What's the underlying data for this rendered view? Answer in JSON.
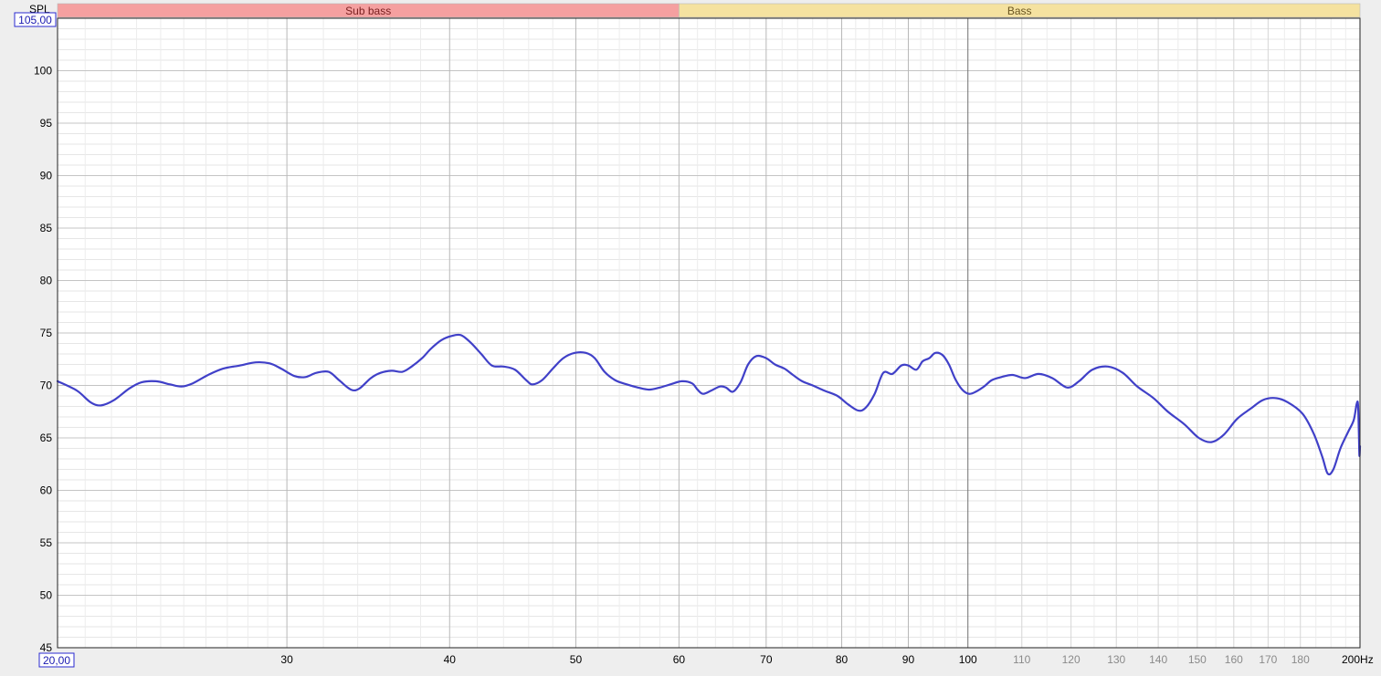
{
  "chart_data": {
    "type": "line",
    "ylabel": "SPL",
    "xunit": "Hz",
    "xscale": "log",
    "xlim": [
      20,
      200
    ],
    "ylim": [
      45,
      105
    ],
    "xlim_box": "20,00",
    "ylim_box": "105,00",
    "grid": true,
    "bands": [
      {
        "name": "Sub bass",
        "from": 20,
        "to": 60,
        "color": "#f5a0a0",
        "text_color": "#7a2020"
      },
      {
        "name": "Bass",
        "from": 60,
        "to": 200,
        "color": "#f5e2a0",
        "text_color": "#6a5520"
      }
    ],
    "x_ticks": [
      {
        "value": 30,
        "label": "30",
        "style": "major"
      },
      {
        "value": 40,
        "label": "40",
        "style": "major"
      },
      {
        "value": 50,
        "label": "50",
        "style": "major"
      },
      {
        "value": 60,
        "label": "60",
        "style": "major"
      },
      {
        "value": 70,
        "label": "70",
        "style": "major"
      },
      {
        "value": 80,
        "label": "80",
        "style": "major"
      },
      {
        "value": 90,
        "label": "90",
        "style": "major"
      },
      {
        "value": 100,
        "label": "100",
        "style": "decade"
      },
      {
        "value": 110,
        "label": "110",
        "style": "minor"
      },
      {
        "value": 120,
        "label": "120",
        "style": "minor"
      },
      {
        "value": 130,
        "label": "130",
        "style": "minor"
      },
      {
        "value": 140,
        "label": "140",
        "style": "minor"
      },
      {
        "value": 150,
        "label": "150",
        "style": "minor"
      },
      {
        "value": 160,
        "label": "160",
        "style": "minor"
      },
      {
        "value": 170,
        "label": "170",
        "style": "minor"
      },
      {
        "value": 180,
        "label": "180",
        "style": "minor"
      },
      {
        "value": 200,
        "label": "200Hz",
        "style": "end"
      }
    ],
    "y_ticks": [
      {
        "value": 45,
        "label": "45"
      },
      {
        "value": 50,
        "label": "50"
      },
      {
        "value": 55,
        "label": "55"
      },
      {
        "value": 60,
        "label": "60"
      },
      {
        "value": 65,
        "label": "65"
      },
      {
        "value": 70,
        "label": "70"
      },
      {
        "value": 75,
        "label": "75"
      },
      {
        "value": 80,
        "label": "80"
      },
      {
        "value": 85,
        "label": "85"
      },
      {
        "value": 90,
        "label": "90"
      },
      {
        "value": 95,
        "label": "95"
      },
      {
        "value": 100,
        "label": "100"
      }
    ],
    "series": [
      {
        "color": "#4040c8",
        "points": [
          [
            20.0,
            70.4
          ],
          [
            20.7,
            69.5
          ],
          [
            21.2,
            68.4
          ],
          [
            21.6,
            68.1
          ],
          [
            22.1,
            68.6
          ],
          [
            22.7,
            69.7
          ],
          [
            23.2,
            70.3
          ],
          [
            23.8,
            70.4
          ],
          [
            24.4,
            70.1
          ],
          [
            24.9,
            69.9
          ],
          [
            25.4,
            70.2
          ],
          [
            26.1,
            71.0
          ],
          [
            26.8,
            71.6
          ],
          [
            27.6,
            71.9
          ],
          [
            28.4,
            72.2
          ],
          [
            29.1,
            72.1
          ],
          [
            29.7,
            71.6
          ],
          [
            30.4,
            70.9
          ],
          [
            31.0,
            70.8
          ],
          [
            31.6,
            71.2
          ],
          [
            32.3,
            71.3
          ],
          [
            32.9,
            70.5
          ],
          [
            33.6,
            69.6
          ],
          [
            34.1,
            69.7
          ],
          [
            34.8,
            70.7
          ],
          [
            35.4,
            71.2
          ],
          [
            36.1,
            71.4
          ],
          [
            36.8,
            71.3
          ],
          [
            37.4,
            71.8
          ],
          [
            38.1,
            72.6
          ],
          [
            38.7,
            73.5
          ],
          [
            39.4,
            74.3
          ],
          [
            40.1,
            74.7
          ],
          [
            40.8,
            74.8
          ],
          [
            41.5,
            74.1
          ],
          [
            42.3,
            73.0
          ],
          [
            43.1,
            71.9
          ],
          [
            44.0,
            71.8
          ],
          [
            44.9,
            71.5
          ],
          [
            45.8,
            70.5
          ],
          [
            46.3,
            70.1
          ],
          [
            47.1,
            70.5
          ],
          [
            48.0,
            71.6
          ],
          [
            48.9,
            72.6
          ],
          [
            49.9,
            73.1
          ],
          [
            50.9,
            73.1
          ],
          [
            51.7,
            72.6
          ],
          [
            52.6,
            71.3
          ],
          [
            53.6,
            70.5
          ],
          [
            54.7,
            70.1
          ],
          [
            55.8,
            69.8
          ],
          [
            56.9,
            69.6
          ],
          [
            58.0,
            69.8
          ],
          [
            59.1,
            70.1
          ],
          [
            60.3,
            70.4
          ],
          [
            61.4,
            70.2
          ],
          [
            62.0,
            69.6
          ],
          [
            62.6,
            69.2
          ],
          [
            63.5,
            69.5
          ],
          [
            64.5,
            69.9
          ],
          [
            65.2,
            69.8
          ],
          [
            66.0,
            69.4
          ],
          [
            66.9,
            70.3
          ],
          [
            67.8,
            72.0
          ],
          [
            68.8,
            72.8
          ],
          [
            70.0,
            72.6
          ],
          [
            71.1,
            72.0
          ],
          [
            72.3,
            71.6
          ],
          [
            73.4,
            71.0
          ],
          [
            74.6,
            70.4
          ],
          [
            76.0,
            70.0
          ],
          [
            77.6,
            69.5
          ],
          [
            79.4,
            69.0
          ],
          [
            80.9,
            68.2
          ],
          [
            82.4,
            67.6
          ],
          [
            83.5,
            67.9
          ],
          [
            84.8,
            69.2
          ],
          [
            86.1,
            71.2
          ],
          [
            87.5,
            71.1
          ],
          [
            88.9,
            71.9
          ],
          [
            90.0,
            71.9
          ],
          [
            91.3,
            71.5
          ],
          [
            92.3,
            72.3
          ],
          [
            93.4,
            72.6
          ],
          [
            94.4,
            73.1
          ],
          [
            95.6,
            72.9
          ],
          [
            96.7,
            72.0
          ],
          [
            97.8,
            70.6
          ],
          [
            99.0,
            69.6
          ],
          [
            100.2,
            69.2
          ],
          [
            101.4,
            69.4
          ],
          [
            102.9,
            69.9
          ],
          [
            104.3,
            70.5
          ],
          [
            106.1,
            70.8
          ],
          [
            108.2,
            71.0
          ],
          [
            110.6,
            70.7
          ],
          [
            113.3,
            71.1
          ],
          [
            116.1,
            70.7
          ],
          [
            119.2,
            69.8
          ],
          [
            121.7,
            70.4
          ],
          [
            124.6,
            71.5
          ],
          [
            128.1,
            71.8
          ],
          [
            131.5,
            71.2
          ],
          [
            134.9,
            69.9
          ],
          [
            138.8,
            68.8
          ],
          [
            142.4,
            67.5
          ],
          [
            146.6,
            66.3
          ],
          [
            150.4,
            65.0
          ],
          [
            153.8,
            64.6
          ],
          [
            157.2,
            65.3
          ],
          [
            160.9,
            66.8
          ],
          [
            164.9,
            67.8
          ],
          [
            168.4,
            68.6
          ],
          [
            172.1,
            68.8
          ],
          [
            176.0,
            68.4
          ],
          [
            180.7,
            67.3
          ],
          [
            184.3,
            65.4
          ],
          [
            187.1,
            63.2
          ],
          [
            188.9,
            61.6
          ],
          [
            190.8,
            62.0
          ],
          [
            193.2,
            64.0
          ],
          [
            195.9,
            65.6
          ],
          [
            197.8,
            66.7
          ],
          [
            198.8,
            68.2
          ],
          [
            199.3,
            68.2
          ],
          [
            199.6,
            65.5
          ],
          [
            199.8,
            63.3
          ],
          [
            200.0,
            64.2
          ]
        ]
      }
    ]
  }
}
